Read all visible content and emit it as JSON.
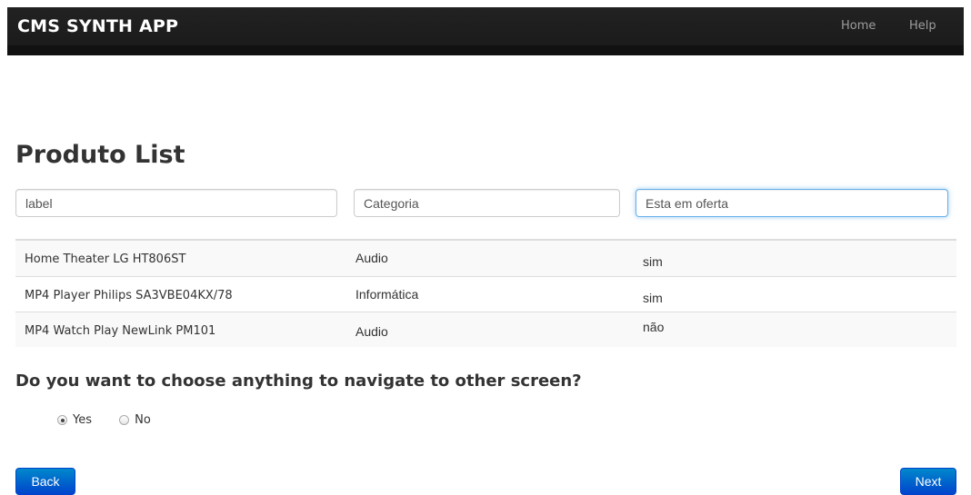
{
  "navbar": {
    "brand": "CMS SYNTH APP",
    "links": [
      "Home",
      "Help"
    ]
  },
  "page": {
    "title": "Produto List"
  },
  "filters": {
    "label_placeholder": "label",
    "categoria_placeholder": "Categoria",
    "oferta_placeholder": "Esta em oferta"
  },
  "table": {
    "rows": [
      {
        "label": "Home Theater LG HT806ST",
        "categoria": "Audio",
        "oferta": "sim"
      },
      {
        "label": "MP4 Player Philips SA3VBE04KX/78",
        "categoria": "Informática",
        "oferta": "sim"
      },
      {
        "label": "MP4 Watch Play NewLink PM101",
        "categoria": "Audio",
        "oferta": "não"
      }
    ]
  },
  "navigation": {
    "question": "Do you want to choose anything to navigate to other screen?",
    "options": [
      "Yes",
      "No"
    ],
    "selected": "Yes"
  },
  "buttons": {
    "back": "Back",
    "next": "Next"
  },
  "colors": {
    "navbar": "#1b1b1b",
    "button": "#0066cc",
    "focus": "#66afe9"
  }
}
